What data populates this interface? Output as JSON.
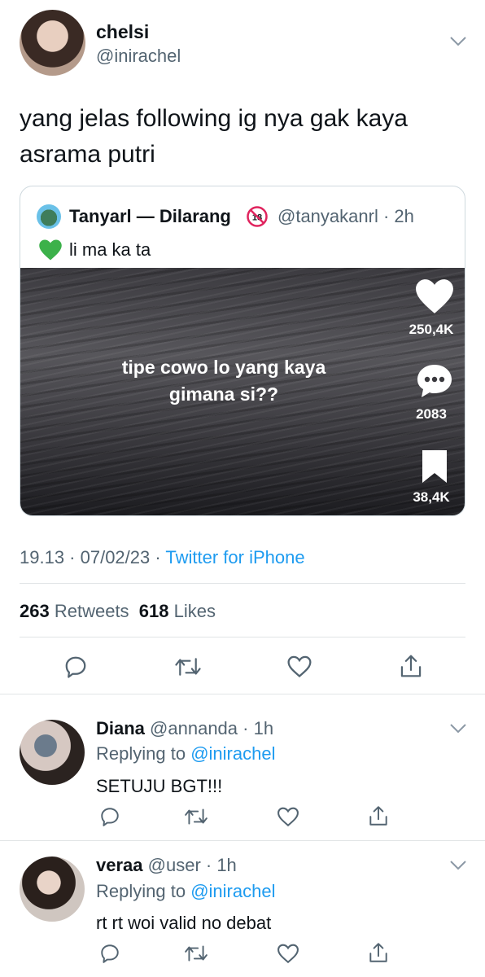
{
  "tweet": {
    "display_name": "chelsi",
    "handle": "@inirachel",
    "text_line1": "yang jelas following ig nya gak kaya",
    "text_line2": "asrama putri",
    "meta": {
      "time_date": "19.13 · 07/02/23 · ",
      "source": "Twitter for iPhone"
    },
    "stats": {
      "retweets_count": "263",
      "retweets_label": "Retweets",
      "likes_count": "618",
      "likes_label": "Likes"
    }
  },
  "quote": {
    "display_name": "Tanyarl — Dilarang",
    "handle_time": "@tanyakanrl · 2h",
    "text": "li ma ka ta",
    "video": {
      "caption_line1": "tipe cowo lo yang kaya",
      "caption_line2": "gimana si??",
      "likes": "250,4K",
      "comments": "2083",
      "saves": "38,4K"
    }
  },
  "replies": [
    {
      "display_name": "Diana",
      "handle_time": "@annanda · 1h",
      "replying_prefix": "Replying to ",
      "replying_to": "@inirachel",
      "text": "SETUJU BGT!!!"
    },
    {
      "display_name": "veraa",
      "handle_time": "@user · 1h",
      "replying_prefix": "Replying to ",
      "replying_to": "@inirachel",
      "text": "rt rt woi valid no debat"
    }
  ],
  "colors": {
    "accent": "#1d9bf0",
    "text": "#0f1419",
    "secondary": "#536471",
    "divider": "#e1e4e6"
  }
}
